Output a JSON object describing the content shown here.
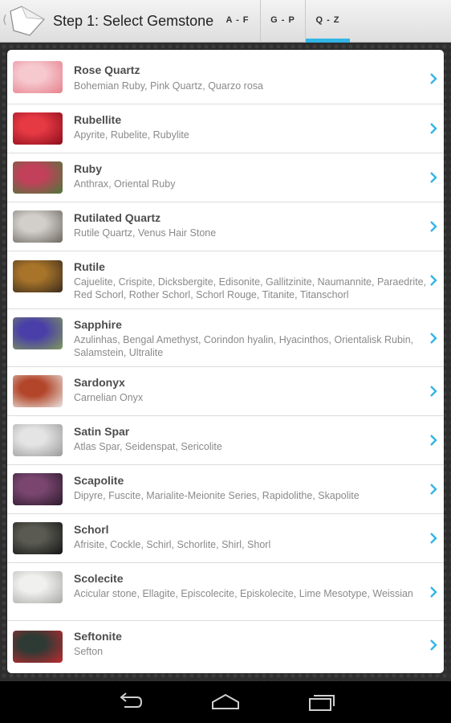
{
  "header": {
    "title": "Step 1: Select Gemstone",
    "tabs": [
      {
        "label": "A - F",
        "selected": false
      },
      {
        "label": "G - P",
        "selected": false
      },
      {
        "label": "Q - Z",
        "selected": true
      }
    ]
  },
  "accent_color": "#33b5e5",
  "gems": [
    {
      "name": "Rose Quartz",
      "aka": "Bohemian Ruby, Pink Quartz, Quarzo rosa",
      "swatch": [
        "#f6c9cf",
        "#e77f8b"
      ]
    },
    {
      "name": "Rubellite",
      "aka": "Apyrite, Rubelite, Rubylite",
      "swatch": [
        "#e53943",
        "#8a0d1a"
      ]
    },
    {
      "name": "Ruby",
      "aka": "Anthrax, Oriental Ruby",
      "swatch": [
        "#c2405a",
        "#4a7a3a"
      ]
    },
    {
      "name": "Rutilated Quartz",
      "aka": "Rutile Quartz, Venus Hair Stone",
      "swatch": [
        "#d2cfcb",
        "#6d6660"
      ]
    },
    {
      "name": "Rutile",
      "aka": "Cajuelite, Crispite, Dicksbergite, Edisonite, Gallitzinite, Naumannite, Paraedrite, Red Schorl, Rother Schorl, Schorl Rouge, Titanite, Titanschorl",
      "swatch": [
        "#a8742a",
        "#3a2a1c"
      ]
    },
    {
      "name": "Sapphire",
      "aka": "Azulinhas, Bengal Amethyst, Corindon hyalin, Hyacinthos, Orientalisk Rubin, Salamstein, Ultralite",
      "swatch": [
        "#4a3fa8",
        "#7f9a5a"
      ]
    },
    {
      "name": "Sardonyx",
      "aka": "Carnelian Onyx",
      "swatch": [
        "#b3462a",
        "#e9e6e2"
      ]
    },
    {
      "name": "Satin Spar",
      "aka": "Atlas Spar, Seidenspat, Sericolite",
      "swatch": [
        "#e4e4e4",
        "#9a9a9a"
      ]
    },
    {
      "name": "Scapolite",
      "aka": "Dipyre, Fuscite, Marialite-Meionite Series, Rapidolithe, Skapolite",
      "swatch": [
        "#7a4670",
        "#2c1a2c"
      ]
    },
    {
      "name": "Schorl",
      "aka": "Afrisite, Cockle, Schirl, Schorlite, Shirl, Shorl",
      "swatch": [
        "#5a5a52",
        "#141414"
      ]
    },
    {
      "name": "Scolecite",
      "aka": "Acicular stone, Ellagite, Episcolecite, Episkolecite, Lime Mesotype, Weissian",
      "swatch": [
        "#f0f0ee",
        "#a9aaa6"
      ]
    },
    {
      "name": "Seftonite",
      "aka": "Sefton",
      "swatch": [
        "#2e3a34",
        "#c02a30"
      ]
    }
  ]
}
